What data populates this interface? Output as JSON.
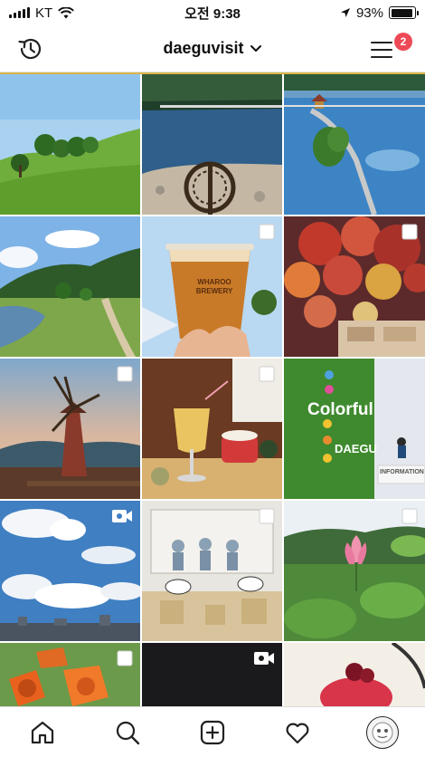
{
  "status_bar": {
    "carrier": "KT",
    "time": "오전 9:38",
    "battery_percent": "93%",
    "battery_level": 0.93
  },
  "header": {
    "username": "daeguvisit",
    "notification_count": "2",
    "left_icon": "history-icon",
    "right_icon": "menu-icon"
  },
  "colors": {
    "badge": "#ed4956",
    "accent_line": "#d9b44a"
  },
  "grid": {
    "tiles": [
      {
        "name": "green-hill",
        "overlay": "none"
      },
      {
        "name": "lake-boardwalk-waterwheel",
        "overlay": "none"
      },
      {
        "name": "lake-pavilion-bridge",
        "overlay": "none"
      },
      {
        "name": "park-pond-mountain",
        "overlay": "none"
      },
      {
        "name": "craft-beer-cup",
        "overlay": "multiple"
      },
      {
        "name": "red-dried-flowers",
        "overlay": "multiple"
      },
      {
        "name": "windmill-sunset",
        "overlay": "multiple"
      },
      {
        "name": "cafe-drink-glass",
        "overlay": "multiple"
      },
      {
        "name": "colorful-daegu-green-wall",
        "overlay": "none"
      },
      {
        "name": "blue-sky-clouds-city",
        "overlay": "video"
      },
      {
        "name": "street-sculpture-exhibit",
        "overlay": "multiple"
      },
      {
        "name": "lotus-flowers-pond",
        "overlay": "multiple"
      },
      {
        "name": "orange-trumpet-flowers",
        "overlay": "multiple"
      },
      {
        "name": "dark-video-tile",
        "overlay": "video"
      },
      {
        "name": "strawberry-dessert",
        "overlay": "none"
      }
    ],
    "beer_cup_print": "WHAROO BREWERY",
    "wall_sign_line1": "Colorful",
    "wall_sign_line2": "DAEGU",
    "desk_sign": "INFORMATION"
  },
  "tabbar": {
    "items": [
      "home-icon",
      "search-icon",
      "add-post-icon",
      "heart-icon",
      "profile-avatar"
    ]
  }
}
